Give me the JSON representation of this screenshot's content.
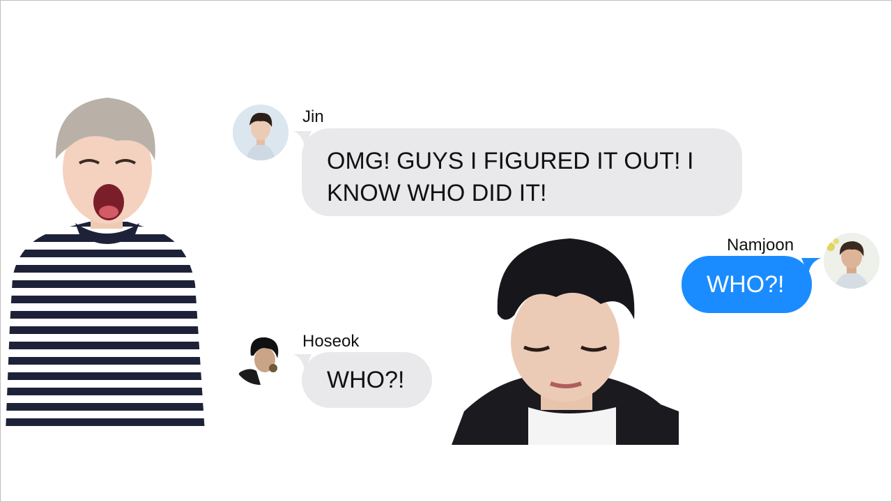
{
  "messages": [
    {
      "sender": "Jin",
      "text_line1": "OMG! GUYS I FIGURED IT OUT!  I",
      "text_line2": "KNOW WHO DID IT!"
    },
    {
      "sender": "Namjoon",
      "text": "WHO?!"
    },
    {
      "sender": "Hoseok",
      "text": "WHO?!"
    }
  ],
  "colors": {
    "received_bubble": "#e9e9eb",
    "sent_bubble": "#1a8cff",
    "background": "#ffffff"
  },
  "icons": {
    "jin_avatar": "avatar-photo",
    "namjoon_avatar": "avatar-photo",
    "hoseok_avatar": "avatar-photo"
  }
}
